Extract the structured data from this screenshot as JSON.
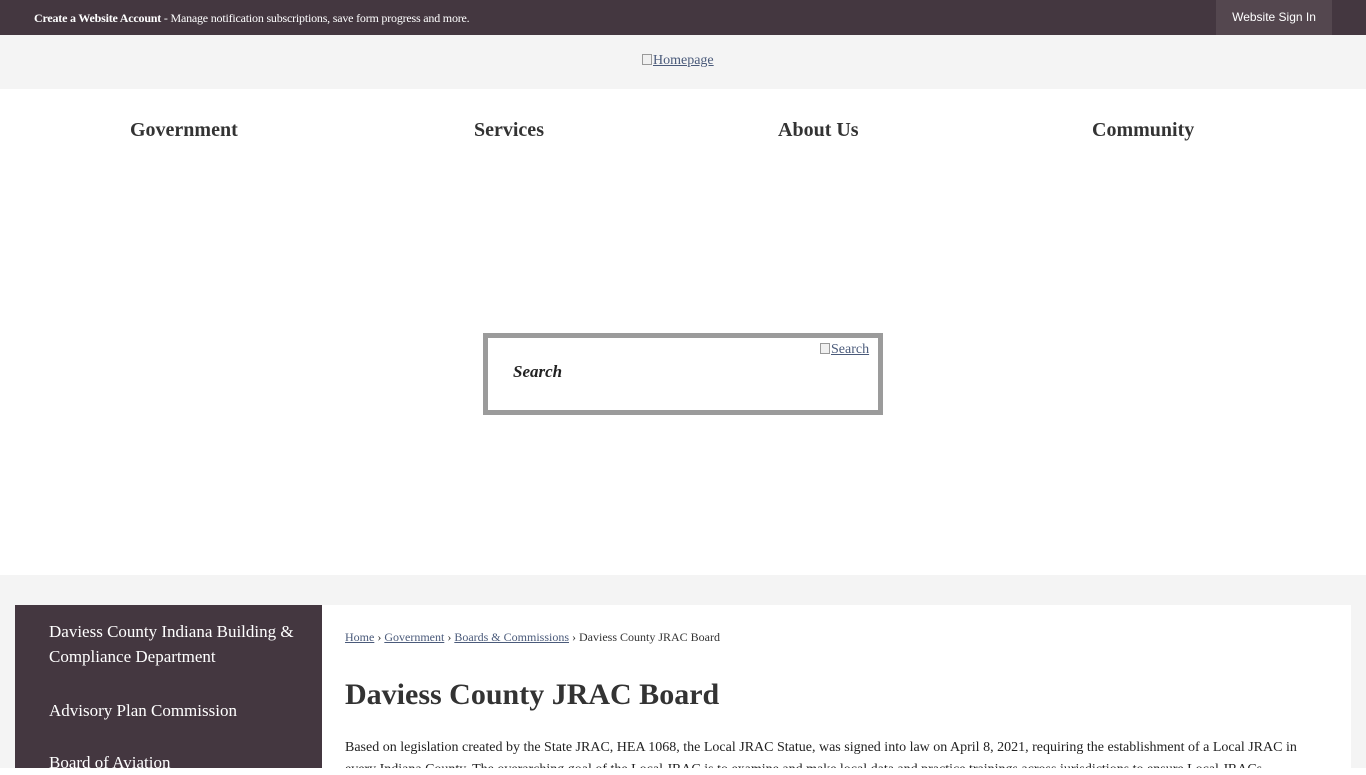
{
  "topbar": {
    "notice_strong": "Create a Website Account",
    "notice_rest": " - Manage notification subscriptions, save form progress and more.",
    "signin_label": "Website Sign In"
  },
  "logo": {
    "alt": "Homepage"
  },
  "nav": {
    "items": [
      {
        "label": "Government"
      },
      {
        "label": "Services"
      },
      {
        "label": "About Us"
      },
      {
        "label": "Community"
      }
    ]
  },
  "search": {
    "placeholder": "Search",
    "button_alt": "Search"
  },
  "sidebar": {
    "items": [
      {
        "label": "Daviess County Indiana Building & Compliance Department"
      },
      {
        "label": "Advisory Plan Commission"
      },
      {
        "label": "Board of Aviation"
      }
    ]
  },
  "breadcrumb": {
    "items": [
      {
        "label": "Home"
      },
      {
        "label": "Government"
      },
      {
        "label": "Boards & Commissions"
      }
    ],
    "current": "Daviess County JRAC Board"
  },
  "page": {
    "title": "Daviess County JRAC Board",
    "body": "Based on legislation created by the State JRAC, HEA 1068, the Local JRAC Statue, was signed into law on April 8, 2021, requiring the establishment of a Local JRAC in every Indiana County. The overarching goal of the Local JRAC is to examine and make local data and practice trainings across jurisdictions to ensure Local JRACs..."
  },
  "colors": {
    "topbar_bg": "#443740",
    "sidebar_bg": "#443740",
    "band_bg": "#f4f4f4",
    "link": "#4a5a7a"
  }
}
